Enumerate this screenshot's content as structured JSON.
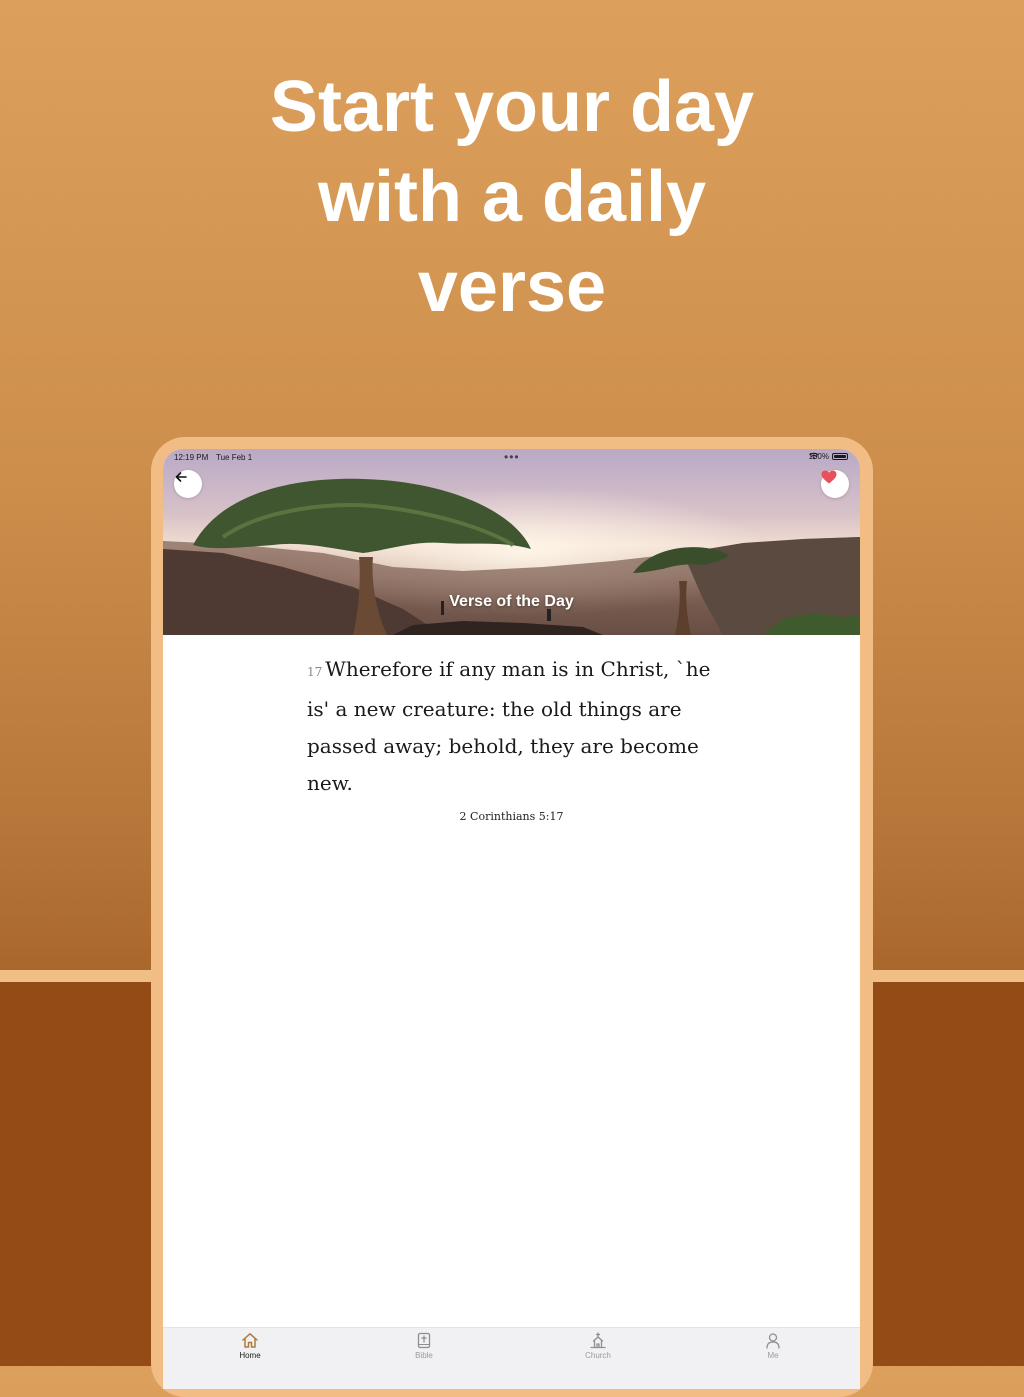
{
  "headline": {
    "lines": [
      "Start your day",
      "with a daily",
      "verse"
    ]
  },
  "status_bar": {
    "time": "12:19 PM",
    "date": "Tue Feb 1",
    "battery": "100%"
  },
  "hero": {
    "title": "Verse of the Day"
  },
  "verse": {
    "number": "17",
    "text": "Wherefore if any man is in Christ, `he is' a new creature: the old things are passed away; behold, they are become new.",
    "reference": "2 Corinthians 5:17"
  },
  "tabs": [
    {
      "label": "Home",
      "icon": "home-icon",
      "active": true
    },
    {
      "label": "Bible",
      "icon": "bible-icon",
      "active": false
    },
    {
      "label": "Church",
      "icon": "church-icon",
      "active": false
    },
    {
      "label": "Me",
      "icon": "person-icon",
      "active": false
    }
  ],
  "colors": {
    "background_top": "#dda05c",
    "background_bottom": "#934c15",
    "device_frame": "#f2bd84",
    "heart": "#e8505b"
  }
}
